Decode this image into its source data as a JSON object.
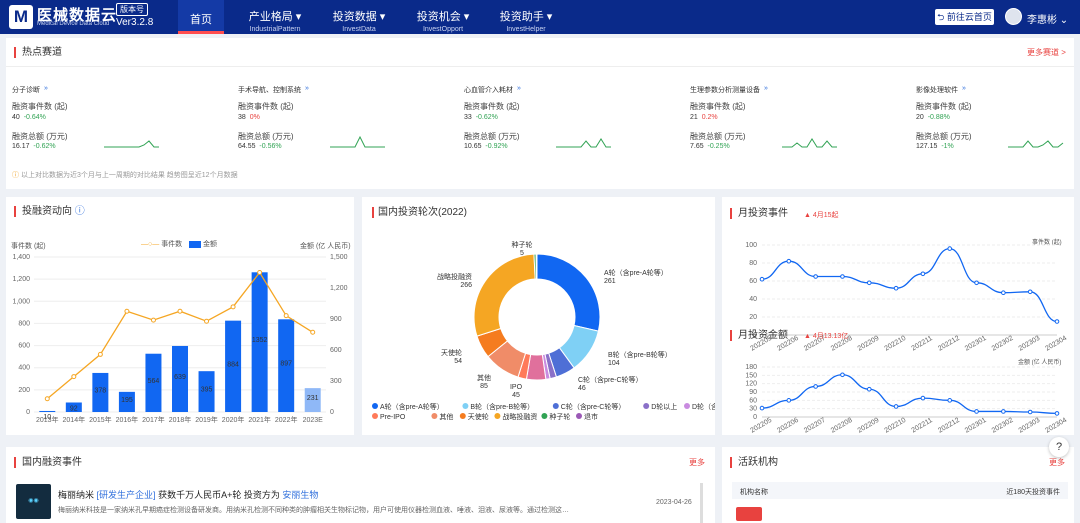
{
  "nav": {
    "brand": "医械数据云",
    "brand_sub": "Medical Device Data Cloud",
    "badge": "版本号",
    "version": "Ver3.2.8",
    "items": [
      {
        "t": "首页",
        "s": ""
      },
      {
        "t": "产业格局",
        "s": "IndustrialPattern"
      },
      {
        "t": "投资数据",
        "s": "InvestData"
      },
      {
        "t": "投资机会",
        "s": "InvestOpport"
      },
      {
        "t": "投资助手",
        "s": "InvestHelper"
      }
    ],
    "home_btn": "前往云首页",
    "user": "李惠彬"
  },
  "hot": {
    "title": "热点赛道",
    "more": "更多赛道 >",
    "count_label": "融资事件数 (起)",
    "amount_label": "融资总额 (万元)",
    "note": "以上对比数据为近3个月与上一周期的对比结果 趋势图呈近12个月数据",
    "items": [
      {
        "name": "分子诊断",
        "count": "40",
        "count_chg": "-0.64%",
        "amount": "16.17",
        "amount_chg": "-0.62%"
      },
      {
        "name": "手术导航、控制系统",
        "count": "38",
        "count_chg": "0%",
        "amount": "64.55",
        "amount_chg": "-0.56%"
      },
      {
        "name": "心血管介入耗材",
        "count": "33",
        "count_chg": "-0.62%",
        "amount": "10.65",
        "amount_chg": "-0.92%"
      },
      {
        "name": "生理参数分析测量设备",
        "count": "21",
        "count_chg": "0.2%",
        "amount": "7.65",
        "amount_chg": "-0.25%"
      },
      {
        "name": "影像处理软件",
        "count": "20",
        "count_chg": "-0.88%",
        "amount": "127.15",
        "amount_chg": "-1%"
      }
    ]
  },
  "trend": {
    "title": "投融资动向",
    "left_unit": "事件数 (起)",
    "right_unit": "金额 (亿 人民币)",
    "legend_count": "事件数",
    "legend_amount": "金额"
  },
  "rounds": {
    "title": "国内投资轮次(2022)"
  },
  "monthly_events": {
    "title": "月投资事件",
    "tag": "4月15起",
    "unit": "事件数 (起)"
  },
  "monthly_amount": {
    "title": "月投资金额",
    "tag": "4月13.13亿",
    "unit": "金额 (亿 人民币)"
  },
  "news": {
    "title": "国内融资事件",
    "more": "更多",
    "company": "梅丽纳米",
    "tag": "[研发生产企业]",
    "headline": "获数千万人民币A+轮 投资方为",
    "investor": "安丽生物",
    "date": "2023-04-26",
    "desc": "梅丽纳米科技是一家纳米孔早期癌症检测设备研发商。用纳米孔检测不同种类的肿瘤相关生物标记物，用户可使用仪器检测血液、唾液、泪液、尿液等。通过检测这…"
  },
  "orgs": {
    "title": "活跃机构",
    "more": "更多",
    "col1": "机构名称",
    "col2": "近180天投资事件"
  },
  "chart_data": [
    {
      "type": "bar",
      "title": "投融资动向",
      "categories": [
        "2013年",
        "2014年",
        "2015年",
        "2016年",
        "2017年",
        "2018年",
        "2019年",
        "2020年",
        "2021年",
        "2022年",
        "2023E"
      ],
      "series": [
        {
          "name": "事件数",
          "type": "line",
          "values": [
            120,
            320,
            520,
            910,
            830,
            910,
            820,
            950,
            1260,
            870,
            720
          ]
        },
        {
          "name": "金额",
          "type": "bar",
          "values": [
            10,
            92,
            378,
            195,
            564,
            639,
            395,
            884,
            1352,
            897,
            231
          ]
        }
      ],
      "ylim_left": [
        0,
        1400
      ],
      "ylim_right": [
        0,
        1500
      ]
    },
    {
      "type": "pie",
      "title": "国内投资轮次(2022)",
      "categories": [
        "A轮（含pre-A轮等）",
        "B轮（含pre-B轮等）",
        "C轮（含pre-C轮等）",
        "D轮以上",
        "D轮（含pre-D轮等）",
        "IPO",
        "Pre-IPO",
        "其他",
        "天使轮",
        "战略投融资",
        "种子轮",
        "退市"
      ],
      "values": [
        261,
        104,
        46,
        15,
        10,
        45,
        20,
        85,
        54,
        266,
        5,
        2
      ]
    },
    {
      "type": "line",
      "title": "月投资事件",
      "x": [
        "202205",
        "202206",
        "202207",
        "202208",
        "202209",
        "202210",
        "202211",
        "202212",
        "202301",
        "202302",
        "202303",
        "202304"
      ],
      "values": [
        62,
        82,
        65,
        65,
        58,
        52,
        68,
        96,
        58,
        47,
        48,
        15
      ],
      "ylim": [
        0,
        100
      ]
    },
    {
      "type": "line",
      "title": "月投资金额",
      "x": [
        "202205",
        "202206",
        "202207",
        "202208",
        "202209",
        "202210",
        "202211",
        "202212",
        "202301",
        "202302",
        "202303",
        "202304"
      ],
      "values": [
        32,
        60,
        110,
        152,
        100,
        38,
        68,
        60,
        20,
        20,
        18,
        13
      ],
      "ylim": [
        0,
        180
      ]
    }
  ]
}
